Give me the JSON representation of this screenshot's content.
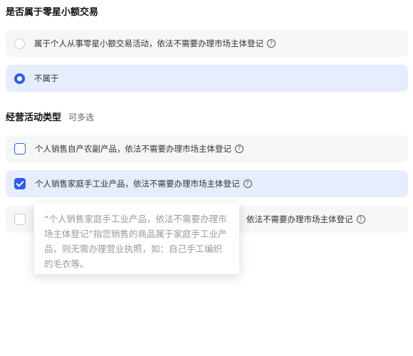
{
  "section1": {
    "title": "是否属于零星小额交易",
    "options": [
      {
        "label": "属于个人从事零星小额交易活动，依法不需要办理市场主体登记",
        "checked": false,
        "help": "?"
      },
      {
        "label": "不属于",
        "checked": true
      }
    ]
  },
  "section2": {
    "title": "经营活动类型",
    "subtitle": "可多选",
    "options": [
      {
        "label": "个人销售自产农副产品，依法不需要办理市场主体登记",
        "checked": false,
        "help": "?"
      },
      {
        "label": "个人销售家庭手工业产品，依法不需要办理市场主体登记",
        "checked": true,
        "help": "?"
      },
      {
        "label": "依法不需要办理市场主体登记",
        "checked": false,
        "help": "?"
      }
    ]
  },
  "tooltip": {
    "text": "“个人销售家庭手工业产品，依法不需要办理市场主体登记”指您销售的商品属于家庭手工业产品，则无需办理营业执照，如：自己手工编织的毛衣等。"
  },
  "colors": {
    "accent": "#2f5bf2",
    "selected_bg": "#e6edff",
    "option_bg": "#f5f6f8"
  }
}
